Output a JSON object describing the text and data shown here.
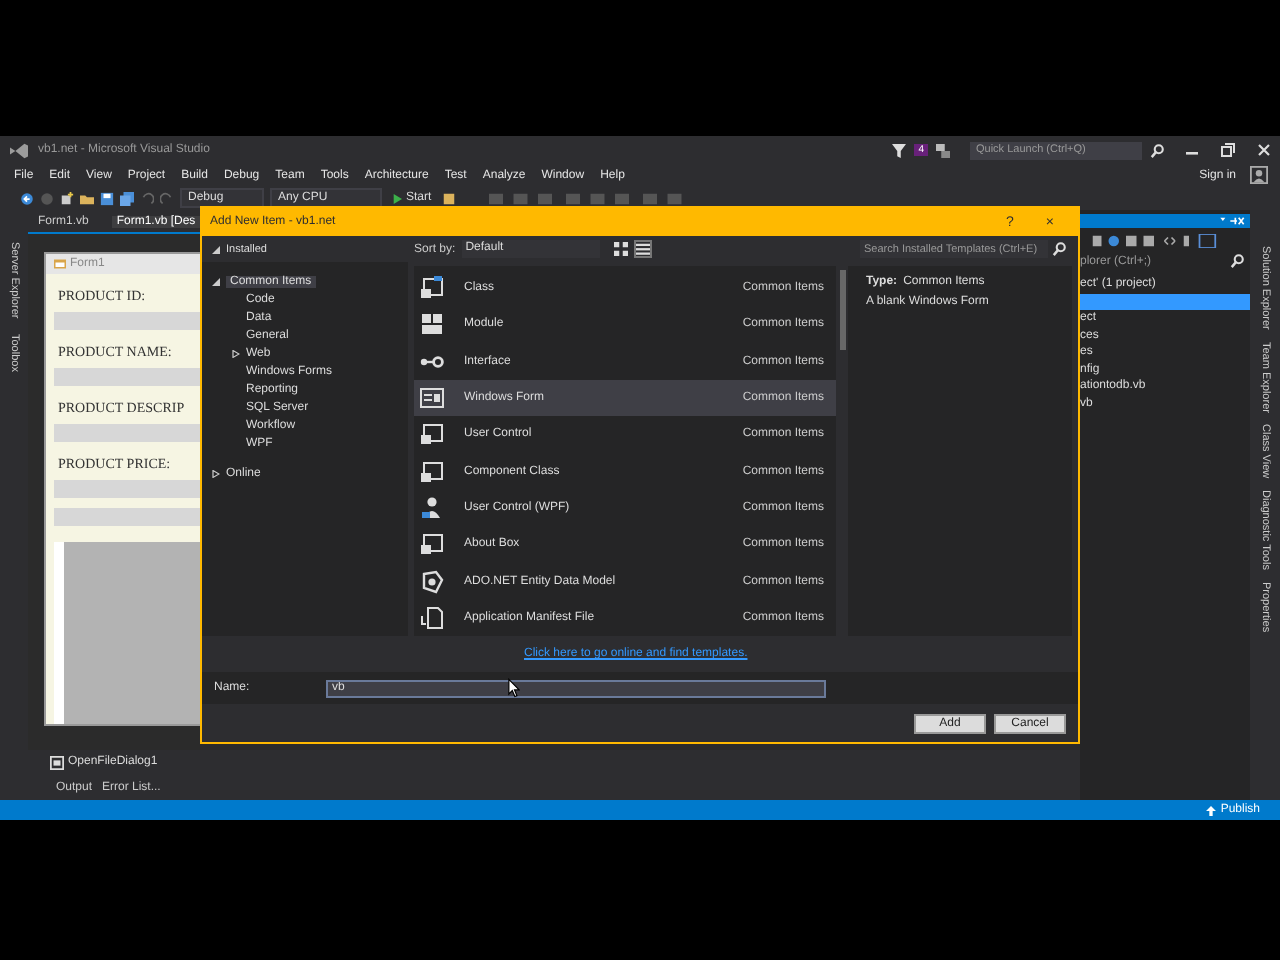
{
  "window": {
    "title": "vb1.net - Microsoft Visual Studio",
    "notification_count": "4",
    "quick_launch": {
      "placeholder": "Quick Launch (Ctrl+Q)"
    },
    "sign_in": "Sign in"
  },
  "menu": [
    "File",
    "Edit",
    "View",
    "Project",
    "Build",
    "Debug",
    "Team",
    "Tools",
    "Architecture",
    "Test",
    "Analyze",
    "Window",
    "Help"
  ],
  "toolbar": {
    "configuration": "Debug",
    "platform": "Any CPU",
    "start": "Start"
  },
  "left_tool_tabs": [
    "Server Explorer",
    "Toolbox"
  ],
  "document_tabs": [
    {
      "label": "Form1.vb",
      "selected": false
    },
    {
      "label": "Form1.vb [Des",
      "selected": true
    }
  ],
  "designer": {
    "form_title": "Form1",
    "fields": [
      {
        "label": "PRODUCT ID:"
      },
      {
        "label": "PRODUCT NAME:"
      },
      {
        "label": "PRODUCT DESCRIP"
      },
      {
        "label": "PRODUCT PRICE:"
      }
    ],
    "component_tray": [
      "OpenFileDialog1"
    ]
  },
  "bottom_tabs": [
    "Output",
    "Error List..."
  ],
  "solution_explorer": {
    "search_placeholder": "plorer (Ctrl+;)",
    "items": [
      {
        "label": "ect' (1 project)",
        "selected": false
      },
      {
        "selected": true
      },
      {
        "label": "ect",
        "selected": false
      },
      {
        "label": "ces",
        "selected": false
      },
      {
        "label": "es",
        "selected": false
      },
      {
        "label": "nfig",
        "selected": false
      },
      {
        "label": "ationtodb.vb",
        "selected": false
      },
      {
        "label": "vb",
        "selected": false
      }
    ]
  },
  "right_tool_tabs": [
    "Solution Explorer",
    "Team Explorer",
    "Class View",
    "Diagnostic Tools",
    "Properties"
  ],
  "status_bar": {
    "publish": "Publish"
  },
  "dialog": {
    "title": "Add New Item - vb1.net",
    "help": "?",
    "close": "×",
    "installed": "Installed",
    "tree": [
      {
        "label": "Common Items",
        "expanded": true,
        "selected": true,
        "children": [
          {
            "label": "Code",
            "kind": "leaf"
          },
          {
            "label": "Data",
            "kind": "leaf"
          },
          {
            "label": "General",
            "kind": "leaf"
          },
          {
            "label": "Web",
            "kind": "folder",
            "expanded": false
          },
          {
            "label": "Windows Forms",
            "kind": "leaf"
          },
          {
            "label": "Reporting",
            "kind": "leaf"
          },
          {
            "label": "SQL Server",
            "kind": "leaf"
          },
          {
            "label": "Workflow",
            "kind": "leaf"
          },
          {
            "label": "WPF",
            "kind": "leaf"
          }
        ]
      },
      {
        "label": "Online",
        "expanded": false,
        "selected": false
      }
    ],
    "sort_label": "Sort by:",
    "sort_value": "Default",
    "search": {
      "placeholder": "Search Installed Templates (Ctrl+E)"
    },
    "templates": [
      {
        "name": "Class",
        "category": "Common Items",
        "selected": false
      },
      {
        "name": "Module",
        "category": "Common Items",
        "selected": false
      },
      {
        "name": "Interface",
        "category": "Common Items",
        "selected": false
      },
      {
        "name": "Windows Form",
        "category": "Common Items",
        "selected": true
      },
      {
        "name": "User Control",
        "category": "Common Items",
        "selected": false
      },
      {
        "name": "Component Class",
        "category": "Common Items",
        "selected": false
      },
      {
        "name": "User Control (WPF)",
        "category": "Common Items",
        "selected": false
      },
      {
        "name": "About Box",
        "category": "Common Items",
        "selected": false
      },
      {
        "name": "ADO.NET Entity Data Model",
        "category": "Common Items",
        "selected": false
      },
      {
        "name": "Application Manifest File",
        "category": "Common Items",
        "selected": false
      }
    ],
    "details": {
      "type_label": "Type:",
      "type_value": "Common Items",
      "description": "A blank Windows Form"
    },
    "online_link": "Click here to go online and find templates.",
    "name_label": "Name:",
    "name_value": "vb",
    "buttons": [
      "Add",
      "Cancel"
    ]
  }
}
